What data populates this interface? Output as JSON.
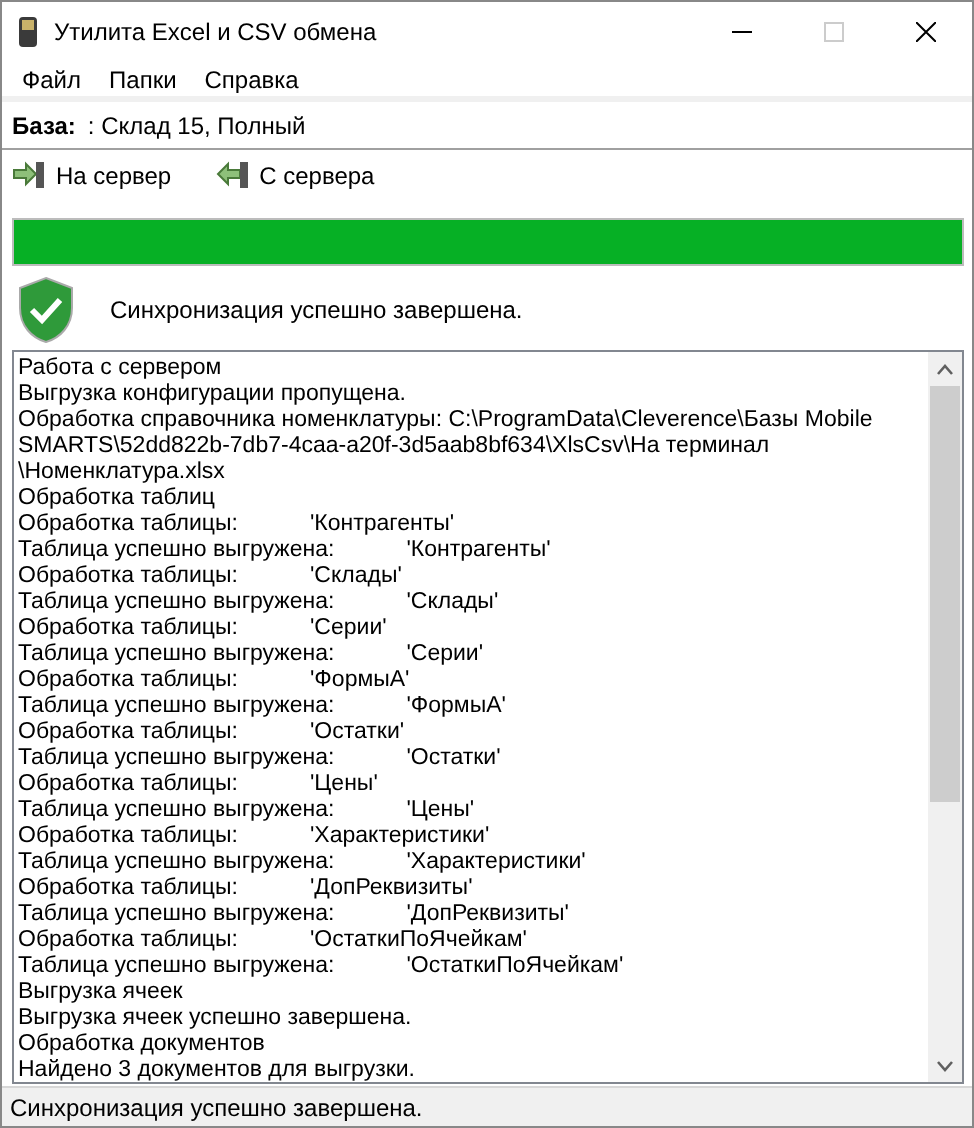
{
  "window": {
    "title": "Утилита Excel и CSV обмена"
  },
  "menu": [
    "Файл",
    "Папки",
    "Справка"
  ],
  "base": {
    "label": "База:",
    "value": ": Склад 15, Полный"
  },
  "toolbar": [
    {
      "label": "На сервер",
      "kind": "upload"
    },
    {
      "label": "С сервера",
      "kind": "download"
    }
  ],
  "progress": {
    "level": 1
  },
  "result": {
    "message": "Синхронизация успешно завершена."
  },
  "log": [
    {
      "text": "Работа с сервером"
    },
    {
      "text": "Выгрузка конфигурации пропущена."
    },
    {
      "text": "Обработка справочника номенклатуры: C:\\ProgramData\\Cleverence\\Базы Mobile"
    },
    {
      "text": "SMARTS\\52dd822b-7db7-4caa-a20f-3d5aab8bf634\\XlsCsv\\На терминал"
    },
    {
      "text": "\\Номенклатура.xlsx"
    },
    {
      "text": "Обработка таблиц"
    },
    {
      "label": "Обработка таблицы:",
      "value": "'Контрагенты'"
    },
    {
      "label": "Таблица успешно выгружена:",
      "value": "'Контрагенты'"
    },
    {
      "label": "Обработка таблицы:",
      "value": "'Склады'"
    },
    {
      "label": "Таблица успешно выгружена:",
      "value": "'Склады'"
    },
    {
      "label": "Обработка таблицы:",
      "value": "'Серии'"
    },
    {
      "label": "Таблица успешно выгружена:",
      "value": "'Серии'"
    },
    {
      "label": "Обработка таблицы:",
      "value": "'ФормыА'"
    },
    {
      "label": "Таблица успешно выгружена:",
      "value": "'ФормыА'"
    },
    {
      "label": "Обработка таблицы:",
      "value": "'Остатки'"
    },
    {
      "label": "Таблица успешно выгружена:",
      "value": "'Остатки'"
    },
    {
      "label": "Обработка таблицы:",
      "value": "'Цены'"
    },
    {
      "label": "Таблица успешно выгружена:",
      "value": "'Цены'"
    },
    {
      "label": "Обработка таблицы:",
      "value": "'Характеристики'"
    },
    {
      "label": "Таблица успешно выгружена:",
      "value": "'Характеристики'"
    },
    {
      "label": "Обработка таблицы:",
      "value": "'ДопРеквизиты'"
    },
    {
      "label": "Таблица успешно выгружена:",
      "value": "'ДопРеквизиты'"
    },
    {
      "label": "Обработка таблицы:",
      "value": "'ОстаткиПоЯчейкам'"
    },
    {
      "label": "Таблица успешно выгружена:",
      "value": "'ОстаткиПоЯчейкам'"
    },
    {
      "text": "Выгрузка ячеек"
    },
    {
      "text": "Выгрузка ячеек успешно завершена."
    },
    {
      "text": "Обработка документов"
    },
    {
      "text": "Найдено 3 документов для выгрузки."
    }
  ],
  "status_bar": {
    "text": "Синхронизация успешно завершена."
  }
}
